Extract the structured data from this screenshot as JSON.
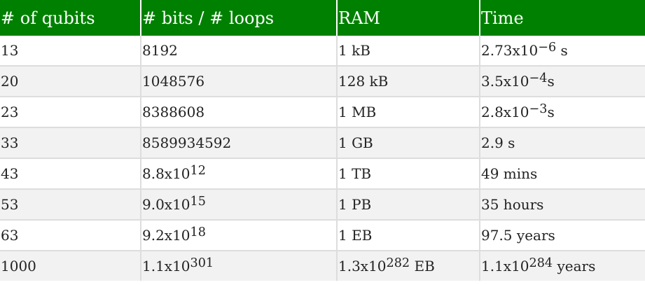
{
  "table": {
    "headers": [
      "# of qubits",
      "# bits / # loops",
      "RAM",
      "Time"
    ],
    "rows": [
      [
        {
          "text": "13"
        },
        {
          "text": "8192"
        },
        {
          "text": "1 kB"
        },
        {
          "base": "2.73x10",
          "exp": "−6",
          "suffix": " s"
        }
      ],
      [
        {
          "text": "20"
        },
        {
          "text": "1048576"
        },
        {
          "text": "128 kB"
        },
        {
          "base": "3.5x10",
          "exp": "−4",
          "suffix": "s"
        }
      ],
      [
        {
          "text": "23"
        },
        {
          "text": "8388608"
        },
        {
          "text": "1 MB"
        },
        {
          "base": "2.8x10",
          "exp": "−3",
          "suffix": "s"
        }
      ],
      [
        {
          "text": "33"
        },
        {
          "text": "8589934592"
        },
        {
          "text": "1 GB"
        },
        {
          "text": "2.9 s"
        }
      ],
      [
        {
          "text": "43"
        },
        {
          "base": "8.8x10",
          "exp": "12",
          "suffix": ""
        },
        {
          "text": "1 TB"
        },
        {
          "text": "49 mins"
        }
      ],
      [
        {
          "text": "53"
        },
        {
          "base": "9.0x10",
          "exp": "15",
          "suffix": ""
        },
        {
          "text": "1 PB"
        },
        {
          "text": "35 hours"
        }
      ],
      [
        {
          "text": "63"
        },
        {
          "base": "9.2x10",
          "exp": "18",
          "suffix": ""
        },
        {
          "text": "1 EB"
        },
        {
          "text": "97.5 years"
        }
      ],
      [
        {
          "text": "1000"
        },
        {
          "base": "1.1x10",
          "exp": "301",
          "suffix": ""
        },
        {
          "base": "1.3x10",
          "exp": "282",
          "suffix": " EB"
        },
        {
          "base": "1.1x10",
          "exp": "284",
          "suffix": " years"
        }
      ]
    ]
  },
  "colors": {
    "header_bg": "#008000",
    "header_text": "#ffffff",
    "row_alt_bg": "#f2f2f2",
    "row_bg": "#ffffff",
    "grid_line": "#dddddd"
  }
}
